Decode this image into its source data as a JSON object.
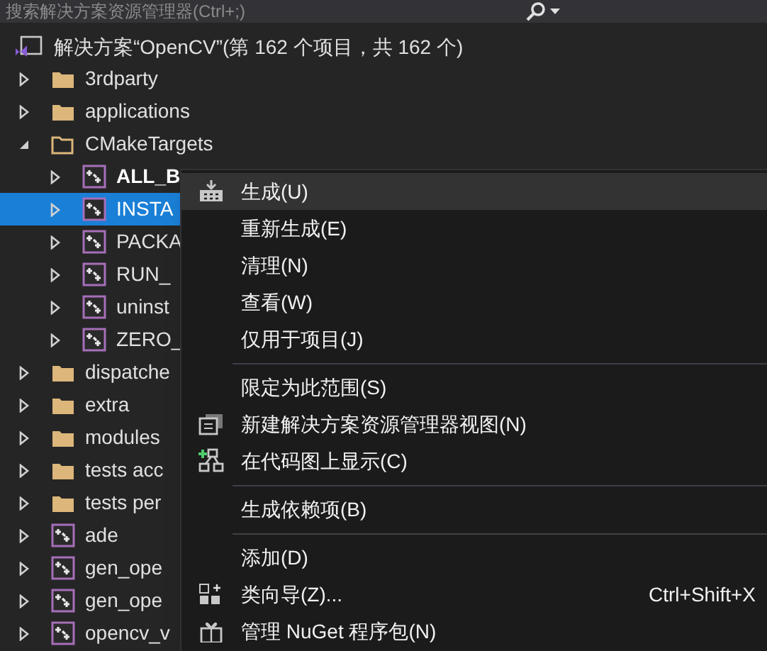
{
  "search": {
    "placeholder": "搜索解决方案资源管理器(Ctrl+;)"
  },
  "solution": {
    "label": "解决方案“OpenCV”(第 162 个项目，共 162 个)",
    "children": [
      {
        "label": "3rdparty",
        "kind": "folder",
        "expanded": false,
        "selected": false,
        "startup": false
      },
      {
        "label": "applications",
        "kind": "folder",
        "expanded": false,
        "selected": false,
        "startup": false
      },
      {
        "label": "CMakeTargets",
        "kind": "folder",
        "expanded": true,
        "selected": false,
        "startup": false,
        "children": [
          {
            "label": "ALL_B",
            "kind": "project",
            "expanded": false,
            "selected": false,
            "startup": true
          },
          {
            "label": "INSTA",
            "kind": "project",
            "expanded": false,
            "selected": true,
            "startup": false
          },
          {
            "label": "PACKA",
            "kind": "project",
            "expanded": false,
            "selected": false,
            "startup": false
          },
          {
            "label": "RUN_",
            "kind": "project",
            "expanded": false,
            "selected": false,
            "startup": false
          },
          {
            "label": "uninst",
            "kind": "project",
            "expanded": false,
            "selected": false,
            "startup": false
          },
          {
            "label": "ZERO_",
            "kind": "project",
            "expanded": false,
            "selected": false,
            "startup": false
          }
        ]
      },
      {
        "label": "dispatche",
        "kind": "folder",
        "expanded": false,
        "selected": false,
        "startup": false
      },
      {
        "label": "extra",
        "kind": "folder",
        "expanded": false,
        "selected": false,
        "startup": false
      },
      {
        "label": "modules",
        "kind": "folder",
        "expanded": false,
        "selected": false,
        "startup": false
      },
      {
        "label": "tests acc",
        "kind": "folder",
        "expanded": false,
        "selected": false,
        "startup": false
      },
      {
        "label": "tests per",
        "kind": "folder",
        "expanded": false,
        "selected": false,
        "startup": false
      },
      {
        "label": "ade",
        "kind": "project",
        "expanded": false,
        "selected": false,
        "startup": false
      },
      {
        "label": "gen_ope",
        "kind": "project",
        "expanded": false,
        "selected": false,
        "startup": false
      },
      {
        "label": "gen_ope",
        "kind": "project",
        "expanded": false,
        "selected": false,
        "startup": false
      },
      {
        "label": "opencv_v",
        "kind": "project",
        "expanded": false,
        "selected": false,
        "startup": false
      }
    ]
  },
  "context_menu": [
    {
      "kind": "build",
      "label": "生成(U)",
      "selected": true
    },
    {
      "kind": "plain",
      "label": "重新生成(E)",
      "selected": false
    },
    {
      "kind": "plain",
      "label": "清理(N)",
      "selected": false
    },
    {
      "kind": "plain",
      "label": "查看(W)",
      "selected": false
    },
    {
      "kind": "plain",
      "label": "仅用于项目(J)",
      "selected": false
    },
    {
      "kind": "separator"
    },
    {
      "kind": "plain",
      "label": "限定为此范围(S)",
      "selected": false
    },
    {
      "kind": "view",
      "label": "新建解决方案资源管理器视图(N)",
      "selected": false
    },
    {
      "kind": "map",
      "label": "在代码图上显示(C)",
      "selected": false
    },
    {
      "kind": "separator"
    },
    {
      "kind": "plain",
      "label": "生成依赖项(B)",
      "selected": false
    },
    {
      "kind": "separator"
    },
    {
      "kind": "plain",
      "label": "添加(D)",
      "selected": false
    },
    {
      "kind": "wizard",
      "label": "类向导(Z)...",
      "shortcut": "Ctrl+Shift+X",
      "selected": false
    },
    {
      "kind": "package",
      "label": "管理 NuGet 程序包(N)",
      "selected": false
    }
  ]
}
